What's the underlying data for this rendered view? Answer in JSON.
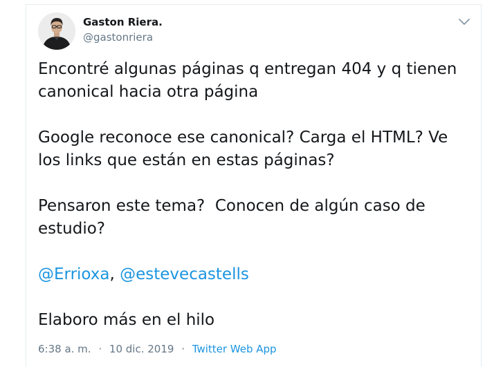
{
  "author": {
    "name": "Gaston Riera.",
    "handle": "@gastonriera"
  },
  "tweet": {
    "para1": "Encontré algunas páginas q entregan 404 y q tienen canonical hacia otra página",
    "para2": "Google reconoce ese canonical? Carga el HTML? Ve los links que están en estas páginas?",
    "para3": "Pensaron este tema?  Conocen de algún caso de estudio?",
    "mention1": "@Errioxa",
    "mention_sep": ", ",
    "mention2": "@estevecastells",
    "para5": "Elaboro más en el hilo"
  },
  "meta": {
    "time": "6:38 a. m.",
    "separator1": "·",
    "date": "10 dic. 2019",
    "separator2": "·",
    "source": "Twitter Web App"
  },
  "icons": {
    "caret": "chevron-down-icon"
  },
  "colors": {
    "text": "#14171a",
    "muted": "#657786",
    "link": "#1b95e0"
  }
}
